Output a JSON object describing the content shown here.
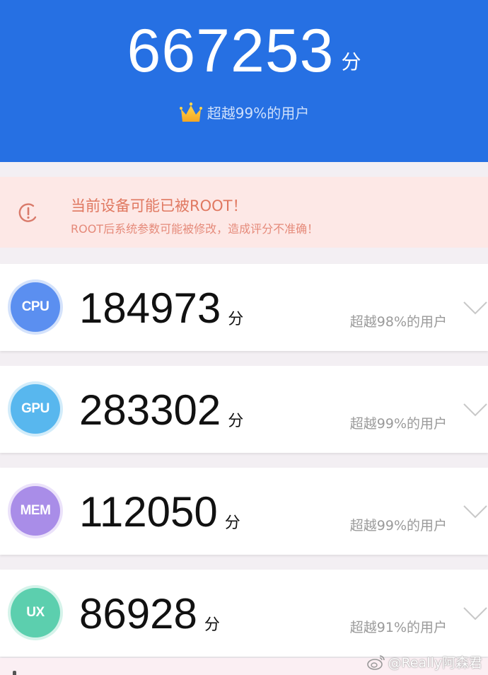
{
  "summary": {
    "total_score": "667253",
    "unit": "分",
    "rank_text": "超越99%的用户",
    "rank_icon": "crown-icon",
    "accent_color": "#2670e3"
  },
  "warning": {
    "icon": "warning-circle-icon",
    "title": "当前设备可能已被ROOT！",
    "subtitle": "ROOT后系统参数可能被修改，造成评分不准确！"
  },
  "categories": [
    {
      "badge": "CPU",
      "score": "184973",
      "unit": "分",
      "rank_text": "超越98%的用户",
      "color": "#5b8ff0"
    },
    {
      "badge": "GPU",
      "score": "283302",
      "unit": "分",
      "rank_text": "超越99%的用户",
      "color": "#58b7ee"
    },
    {
      "badge": "MEM",
      "score": "112050",
      "unit": "分",
      "rank_text": "超越99%的用户",
      "color": "#a98de8"
    },
    {
      "badge": "UX",
      "score": "86928",
      "unit": "分",
      "rank_text": "超越91%的用户",
      "color": "#5ccfae"
    }
  ],
  "watermark": {
    "icon": "weibo-icon",
    "text": "@Really阿森君"
  }
}
